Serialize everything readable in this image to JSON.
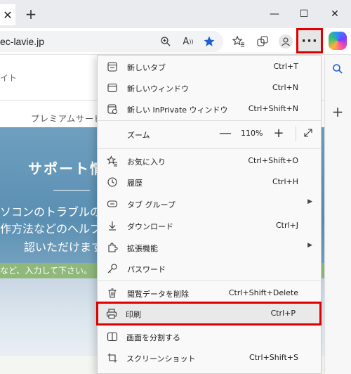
{
  "titlebar": {
    "tab_close": "✕",
    "new_tab": "+",
    "minimize": "—",
    "maximize": "☐",
    "close": "✕"
  },
  "address": {
    "url": "ec-lavie.jp"
  },
  "toolbar_icons": [
    "zoom-icon",
    "read-aloud-icon",
    "favorite-star-icon",
    "favorites-icon",
    "collections-icon",
    "profile-icon"
  ],
  "more_button": "···",
  "page": {
    "header_text": "イト",
    "nav_text": "プレミアムサービ",
    "hero_title": "サポート情",
    "hero_line1": "ソコンのトラブルの",
    "hero_line2": "作方法などのヘルプ",
    "hero_line3": "認いただけます",
    "search_hint": "など、入力して下さい。"
  },
  "menu": {
    "items": [
      {
        "label": "新しいタブ",
        "shortcut": "Ctrl+T",
        "icon": "new-tab-icon"
      },
      {
        "label": "新しいウィンドウ",
        "shortcut": "Ctrl+N",
        "icon": "new-window-icon"
      },
      {
        "label": "新しい InPrivate ウィンドウ",
        "shortcut": "Ctrl+Shift+N",
        "icon": "inprivate-icon"
      },
      {
        "label": "ズーム",
        "shortcut": "",
        "icon": ""
      },
      {
        "label": "お気に入り",
        "shortcut": "Ctrl+Shift+O",
        "icon": "favorites-icon"
      },
      {
        "label": "履歴",
        "shortcut": "Ctrl+H",
        "icon": "history-icon"
      },
      {
        "label": "タブ グループ",
        "shortcut": "",
        "icon": "tab-groups-icon"
      },
      {
        "label": "ダウンロード",
        "shortcut": "Ctrl+J",
        "icon": "download-icon"
      },
      {
        "label": "拡張機能",
        "shortcut": "",
        "icon": "extensions-icon"
      },
      {
        "label": "パスワード",
        "shortcut": "",
        "icon": "password-icon"
      },
      {
        "label": "閲覧データを削除",
        "shortcut": "Ctrl+Shift+Delete",
        "icon": "trash-icon"
      },
      {
        "label": "印刷",
        "shortcut": "Ctrl+P",
        "icon": "print-icon"
      },
      {
        "label": "画面を分割する",
        "shortcut": "",
        "icon": "split-screen-icon"
      },
      {
        "label": "スクリーンショット",
        "shortcut": "Ctrl+Shift+S",
        "icon": "screenshot-icon"
      }
    ],
    "zoom": {
      "minus": "—",
      "value": "110%",
      "plus": "+"
    }
  },
  "colors": {
    "highlight": "#e00000",
    "accent_star": "#1a5fd6"
  }
}
